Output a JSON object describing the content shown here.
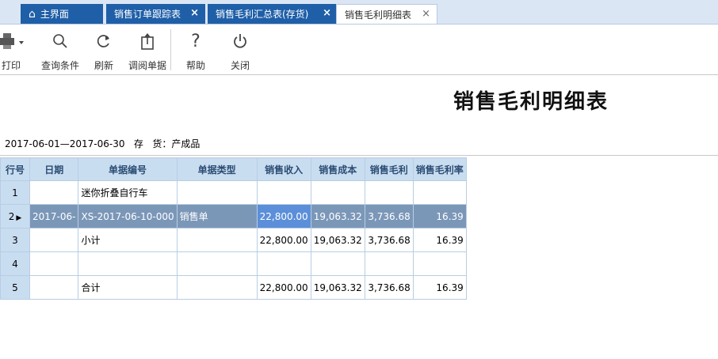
{
  "tabs": [
    {
      "label": "主界面",
      "icon": "home-icon"
    },
    {
      "label": "销售订单跟踪表",
      "close": "×"
    },
    {
      "label": "销售毛利汇总表(存货)",
      "close": "×"
    },
    {
      "label": "销售毛利明细表",
      "close": "×"
    }
  ],
  "toolbar": {
    "print_label": "打印",
    "query_label": "查询条件",
    "refresh_label": "刷新",
    "view_doc_label": "调阅单据",
    "help_label": "帮助",
    "close_label": "关闭",
    "help_glyph": "?"
  },
  "report": {
    "title": "销售毛利明细表",
    "filter_text": "2017-06-01—2017-06-30   存   货：产成品"
  },
  "grid": {
    "headers": [
      "行号",
      "日期",
      "单据编号",
      "单据类型",
      "销售收入",
      "销售成本",
      "销售毛利",
      "销售毛利率"
    ],
    "rows": [
      {
        "no": "1",
        "date": "",
        "doc_no": "迷你折叠自行车",
        "doc_type": "",
        "revenue": "",
        "cost": "",
        "profit": "",
        "rate": ""
      },
      {
        "no": "2",
        "date": "2017-06-",
        "doc_no": "XS-2017-06-10-000",
        "doc_type": "销售单",
        "revenue": "22,800.00",
        "cost": "19,063.32",
        "profit": "3,736.68",
        "rate": "16.39"
      },
      {
        "no": "3",
        "date": "",
        "doc_no": "小计",
        "doc_type": "",
        "revenue": "22,800.00",
        "cost": "19,063.32",
        "profit": "3,736.68",
        "rate": "16.39"
      },
      {
        "no": "4",
        "date": "",
        "doc_no": "",
        "doc_type": "",
        "revenue": "",
        "cost": "",
        "profit": "",
        "rate": ""
      },
      {
        "no": "5",
        "date": "",
        "doc_no": "合计",
        "doc_type": "",
        "revenue": "22,800.00",
        "cost": "19,063.32",
        "profit": "3,736.68",
        "rate": "16.39"
      }
    ],
    "selected_row_marker": "▶"
  },
  "colors": {
    "tab_dark": "#1f5fa8",
    "header_bg": "#c9ddf1",
    "selected_row": "#7b97b8",
    "focus_cell": "#5b8fd9"
  }
}
